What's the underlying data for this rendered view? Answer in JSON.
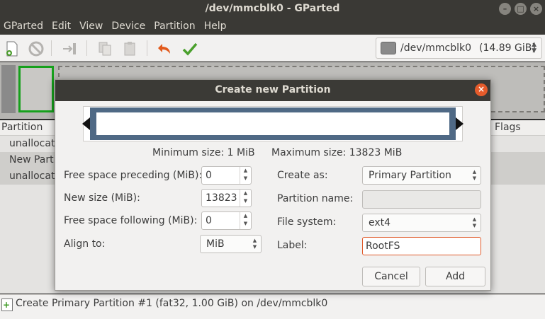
{
  "window": {
    "title": "/dev/mmcblk0 - GParted",
    "controls": [
      "–",
      "□",
      "×"
    ]
  },
  "menubar": {
    "items": [
      "GParted",
      "Edit",
      "View",
      "Device",
      "Partition",
      "Help"
    ]
  },
  "toolbar": {
    "device_path": "/dev/mmcblk0",
    "device_size": "(14.89 GiB)"
  },
  "partition_list": {
    "columns": {
      "partition": "Partition",
      "flags": "Flags"
    },
    "rows": [
      "unallocated",
      "New Partition",
      "unallocated"
    ]
  },
  "dialog": {
    "title": "Create new Partition",
    "min_size": "Minimum size: 1 MiB",
    "max_size": "Maximum size: 13823 MiB",
    "labels": {
      "free_preceding": "Free space preceding (MiB):",
      "new_size": "New size (MiB):",
      "free_following": "Free space following (MiB):",
      "align_to": "Align to:",
      "create_as": "Create as:",
      "partition_name": "Partition name:",
      "file_system": "File system:",
      "label": "Label:"
    },
    "values": {
      "free_preceding": "0",
      "new_size": "13823",
      "free_following": "0",
      "align_to": "MiB",
      "create_as": "Primary Partition",
      "partition_name": "",
      "file_system": "ext4",
      "label": "RootFS"
    },
    "buttons": {
      "cancel": "Cancel",
      "add": "Add"
    }
  },
  "statusbar": {
    "text": "Create Primary Partition #1 (fat32, 1.00 GiB) on /dev/mmcblk0"
  }
}
